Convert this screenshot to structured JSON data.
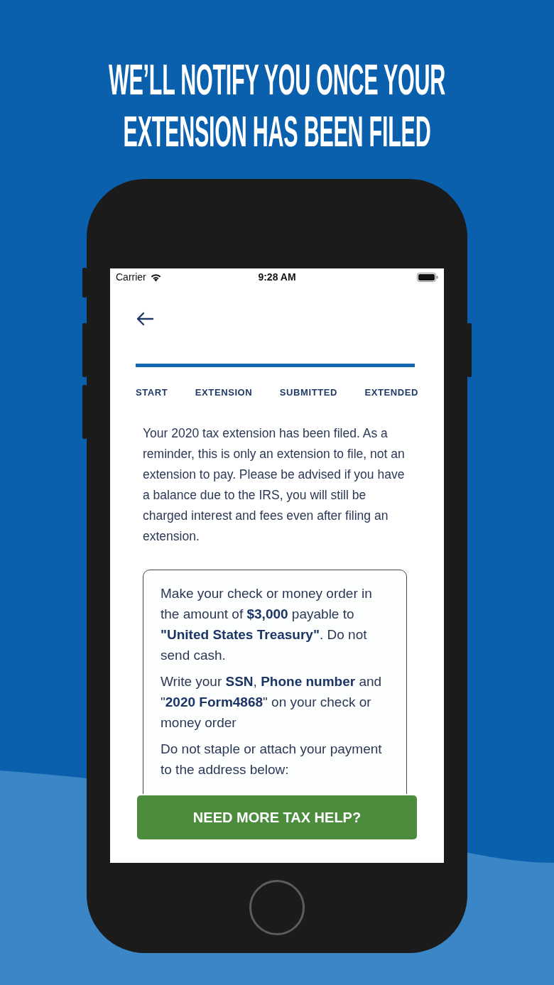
{
  "headline": "WE’LL NOTIFY YOU ONCE YOUR EXTENSION HAS BEEN FILED",
  "status_bar": {
    "carrier": "Carrier",
    "time": "9:28 AM"
  },
  "progress": {
    "level": 1
  },
  "steps": [
    "START",
    "EXTENSION",
    "SUBMITTED",
    "EXTENDED"
  ],
  "message": "Your 2020 tax extension has been filed. As a reminder, this is only an extension to file, not an extension to pay. Please be advised if you have a balance due to the IRS, you will still be charged interest and fees even after filing an extension.",
  "instructions": [
    "Make your check or money order in the amount of **$3,000** payable to **\"United States Treasury\"**. Do not send cash.",
    "Write your **SSN**, **Phone number** and \"**2020 Form4868**\" on your check or money order",
    "Do not staple or attach your payment to the address below:"
  ],
  "help_button": "NEED MORE TAX HELP?"
}
